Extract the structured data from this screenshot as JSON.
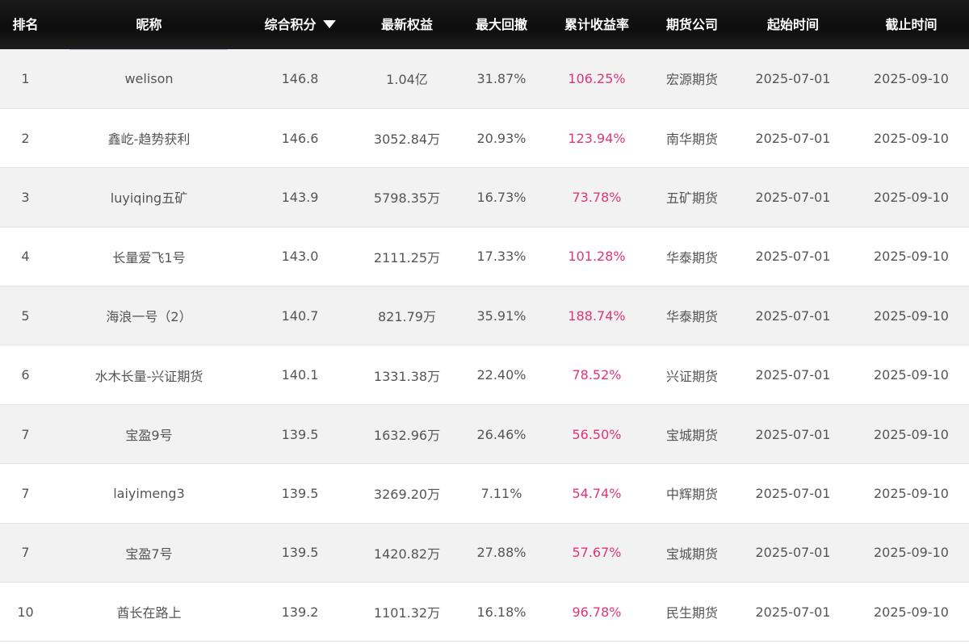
{
  "headers": {
    "rank": "排名",
    "nickname": "昵称",
    "score": "综合积分",
    "equity": "最新权益",
    "drawdown": "最大回撤",
    "return_rate": "累计收益率",
    "company": "期货公司",
    "start": "起始时间",
    "end": "截止时间"
  },
  "sort_icon": "caret-down-icon",
  "colors": {
    "return_rate": "#e0357a",
    "header_bg": "#111111"
  },
  "rows": [
    {
      "rank": "1",
      "nickname": "welison",
      "score": "146.8",
      "equity": "1.04亿",
      "drawdown": "31.87%",
      "return_rate": "106.25%",
      "company": "宏源期货",
      "start": "2025-07-01",
      "end": "2025-09-10"
    },
    {
      "rank": "2",
      "nickname": "鑫屹-趋势获利",
      "score": "146.6",
      "equity": "3052.84万",
      "drawdown": "20.93%",
      "return_rate": "123.94%",
      "company": "南华期货",
      "start": "2025-07-01",
      "end": "2025-09-10"
    },
    {
      "rank": "3",
      "nickname": "luyiqing五矿",
      "score": "143.9",
      "equity": "5798.35万",
      "drawdown": "16.73%",
      "return_rate": "73.78%",
      "company": "五矿期货",
      "start": "2025-07-01",
      "end": "2025-09-10"
    },
    {
      "rank": "4",
      "nickname": "长量爱飞1号",
      "score": "143.0",
      "equity": "2111.25万",
      "drawdown": "17.33%",
      "return_rate": "101.28%",
      "company": "华泰期货",
      "start": "2025-07-01",
      "end": "2025-09-10"
    },
    {
      "rank": "5",
      "nickname": "海浪一号（2）",
      "score": "140.7",
      "equity": "821.79万",
      "drawdown": "35.91%",
      "return_rate": "188.74%",
      "company": "华泰期货",
      "start": "2025-07-01",
      "end": "2025-09-10"
    },
    {
      "rank": "6",
      "nickname": "水木长量-兴证期货",
      "score": "140.1",
      "equity": "1331.38万",
      "drawdown": "22.40%",
      "return_rate": "78.52%",
      "company": "兴证期货",
      "start": "2025-07-01",
      "end": "2025-09-10"
    },
    {
      "rank": "7",
      "nickname": "宝盈9号",
      "score": "139.5",
      "equity": "1632.96万",
      "drawdown": "26.46%",
      "return_rate": "56.50%",
      "company": "宝城期货",
      "start": "2025-07-01",
      "end": "2025-09-10"
    },
    {
      "rank": "7",
      "nickname": "laiyimeng3",
      "score": "139.5",
      "equity": "3269.20万",
      "drawdown": "7.11%",
      "return_rate": "54.74%",
      "company": "中辉期货",
      "start": "2025-07-01",
      "end": "2025-09-10"
    },
    {
      "rank": "7",
      "nickname": "宝盈7号",
      "score": "139.5",
      "equity": "1420.82万",
      "drawdown": "27.88%",
      "return_rate": "57.67%",
      "company": "宝城期货",
      "start": "2025-07-01",
      "end": "2025-09-10"
    },
    {
      "rank": "10",
      "nickname": "酋长在路上",
      "score": "139.2",
      "equity": "1101.32万",
      "drawdown": "16.18%",
      "return_rate": "96.78%",
      "company": "民生期货",
      "start": "2025-07-01",
      "end": "2025-09-10"
    }
  ]
}
